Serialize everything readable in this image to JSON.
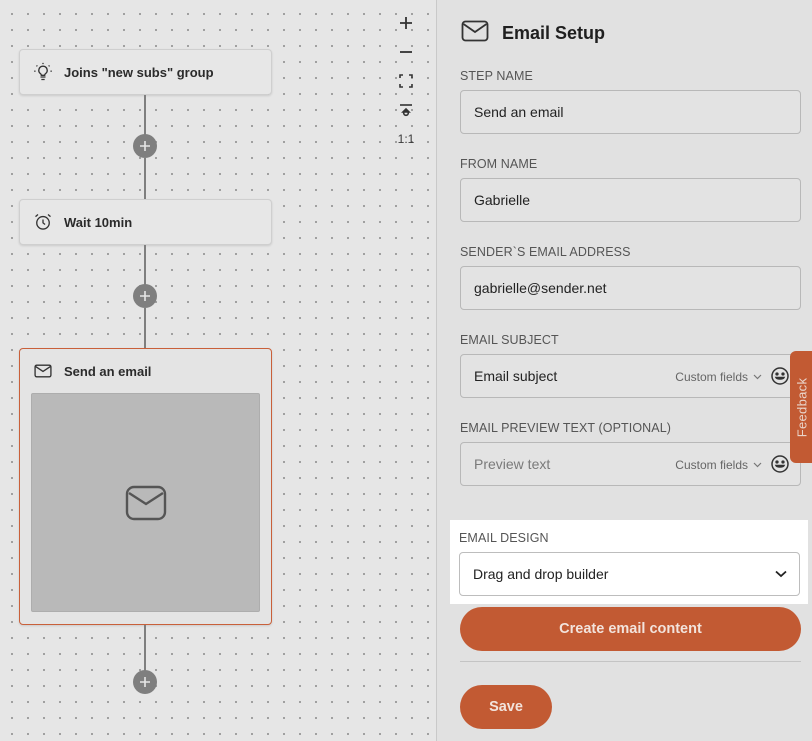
{
  "canvas": {
    "nodes": [
      {
        "title": "Joins \"new subs\" group",
        "icon": "lightbulb-icon"
      },
      {
        "title": "Wait 10min",
        "icon": "alarm-clock-icon"
      },
      {
        "title": "Send an email",
        "icon": "envelope-icon"
      }
    ],
    "zoom_controls": {
      "zoom_in": "+",
      "zoom_out": "−",
      "fit": "fit-screen-icon",
      "center": "center-icon",
      "reset": "1:1"
    }
  },
  "panel": {
    "title": "Email Setup",
    "fields": {
      "step_name": {
        "label": "STEP NAME",
        "value": "Send an email"
      },
      "from_name": {
        "label": "FROM NAME",
        "value": "Gabrielle"
      },
      "sender_email": {
        "label": "SENDER`S EMAIL ADDRESS",
        "value": "gabrielle@sender.net"
      },
      "subject": {
        "label": "EMAIL SUBJECT",
        "value": "Email subject",
        "custom_fields": "Custom fields"
      },
      "preview": {
        "label": "EMAIL PREVIEW TEXT (OPTIONAL)",
        "placeholder": "Preview text",
        "custom_fields": "Custom fields"
      }
    },
    "design": {
      "label": "EMAIL DESIGN",
      "selected": "Drag and drop builder"
    },
    "create_button": "Create email content",
    "save_button": "Save"
  },
  "feedback_tab": "Feedback",
  "colors": {
    "accent": "#c25a33",
    "node_highlight": "#c9603a"
  }
}
